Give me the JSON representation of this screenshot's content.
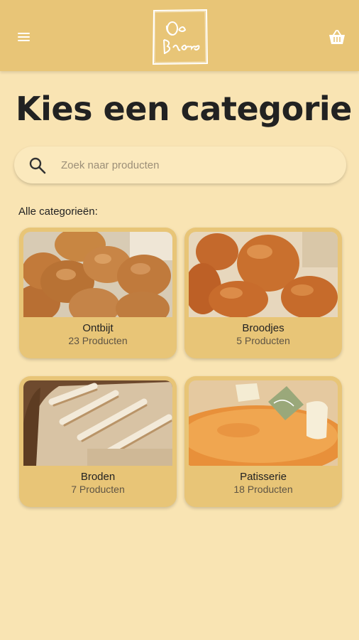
{
  "header": {
    "menu_icon": "menu-icon",
    "cart_icon": "basket-icon",
    "logo_text": "De Baere",
    "background_color": "#e8c577"
  },
  "page": {
    "title": "Kies een categorie",
    "background_color": "#f9e4b3"
  },
  "search": {
    "placeholder": "Zoek naar producten",
    "value": "",
    "icon": "search-icon"
  },
  "categories_label": "Alle categorieën:",
  "categories": [
    {
      "name": "Ontbijt",
      "count": "23 Producten",
      "image": "bread-rolls-photo"
    },
    {
      "name": "Broodjes",
      "count": "5 Producten",
      "image": "soft-buns-photo"
    },
    {
      "name": "Broden",
      "count": "7 Producten",
      "image": "bread-loaves-photo"
    },
    {
      "name": "Patisserie",
      "count": "18 Producten",
      "image": "tart-photo"
    }
  ]
}
